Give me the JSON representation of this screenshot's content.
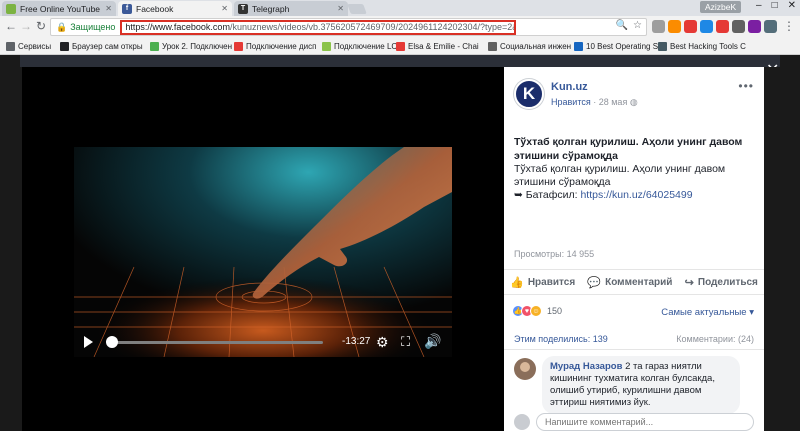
{
  "browser": {
    "tabs": [
      {
        "title": "Free Online YouTube Do",
        "favicon_color": "#7cb342"
      },
      {
        "title": "Facebook",
        "favicon_color": "#3b5998",
        "favicon_glyph": "f"
      },
      {
        "title": "Telegraph",
        "favicon_color": "#333333",
        "favicon_glyph": "T"
      }
    ],
    "user": "AzizbeK",
    "secure_label": "Защищено",
    "url_host": "https://www.facebook.com",
    "url_path": "/kunuznews/videos/vb.375620572469709/2024961124202304/?type=2&theater"
  },
  "bookmarks": [
    {
      "label": "Сервисы",
      "color": "#5f6368"
    },
    {
      "label": "Браузер сам откры",
      "color": "#202124"
    },
    {
      "label": "Урок 2. Подключен",
      "color": "#4caf50"
    },
    {
      "label": "Подключение дисп",
      "color": "#e53935"
    },
    {
      "label": "Подключение LCD",
      "color": "#8bc34a"
    },
    {
      "label": "Elsa & Emilie - Chai",
      "color": "#e53935"
    },
    {
      "label": "Социальная инжен",
      "color": "#616161"
    },
    {
      "label": "10 Best Operating S",
      "color": "#1565c0"
    },
    {
      "label": "Best Hacking Tools C",
      "color": "#455a64"
    }
  ],
  "player": {
    "time_remaining": "-13:27"
  },
  "post": {
    "page_name": "Kun.uz",
    "avatar_letter": "K",
    "liked_label": "Нравится",
    "date": "28 мая",
    "title": "Тўхтаб қолган қурилиш. Аҳоли унинг давом этишини сўрамоқда",
    "body": "Тўхтаб қолган қурилиш. Аҳоли унинг давом этишини сўрамоқда",
    "link_prefix": "➥ Батафсил:",
    "link": "https://kun.uz/64025499",
    "views": "Просмотры: 14 955",
    "actions": {
      "like": "Нравится",
      "comment": "Комментарий",
      "share": "Поделиться"
    },
    "reactions_count": "150",
    "sort_label": "Самые актуальные",
    "shares": "Этим поделились: 139",
    "comments_count": "Комментарии: (24)",
    "comment": {
      "author": "Мурад Назаров",
      "text": "2 та гараз ниятли кишининг тухматига колган булсакда, олишиб утириб, курилишни давом эттириш ниятимиз йук."
    },
    "comment_placeholder": "Напишите комментарий..."
  }
}
